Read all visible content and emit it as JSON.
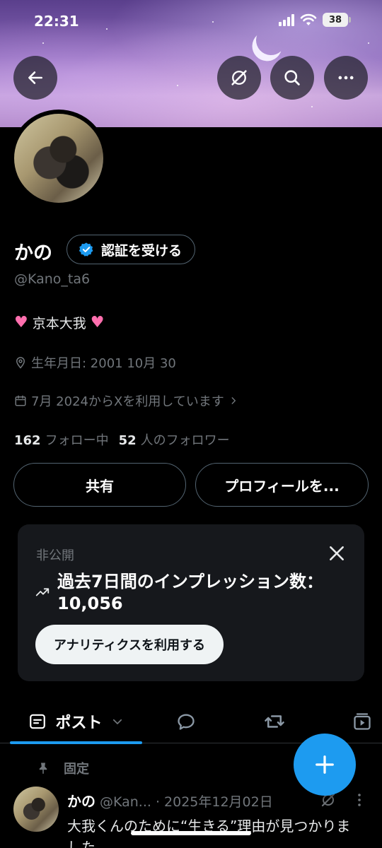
{
  "status_bar": {
    "time": "22:31",
    "battery": "38"
  },
  "profile": {
    "name": "かの",
    "verify_label": "認証を受ける",
    "handle": "@Kano_ta6",
    "bio_text": "京本大我",
    "birthday": "生年月日: 2001 10月 30",
    "joined": "7月 2024からXを利用しています",
    "following_count": "162",
    "following_label": "フォロー中",
    "followers_count": "52",
    "followers_label": "人のフォロワー"
  },
  "buttons": {
    "share": "共有",
    "edit_profile": "プロフィールを..."
  },
  "analytics_card": {
    "private_label": "非公開",
    "title": "過去7日間のインプレッション数：10,056",
    "cta": "アナリティクスを利用する"
  },
  "tabs": {
    "posts_label": "ポスト"
  },
  "pinned_post": {
    "pinned_label": "固定",
    "author": "かの",
    "handle": "@Kan...",
    "date": "· 2025年12月02日",
    "text": "大我くんのために“生きる”理由が見つかりました"
  },
  "colors": {
    "accent": "#1d9bf0",
    "background": "#000000",
    "muted": "#71767b"
  },
  "icons": [
    "back-arrow-icon",
    "grok-icon",
    "search-icon",
    "more-icon",
    "location-icon",
    "calendar-icon",
    "verified-badge-icon",
    "trend-icon",
    "close-icon",
    "compose-plus-icon"
  ]
}
